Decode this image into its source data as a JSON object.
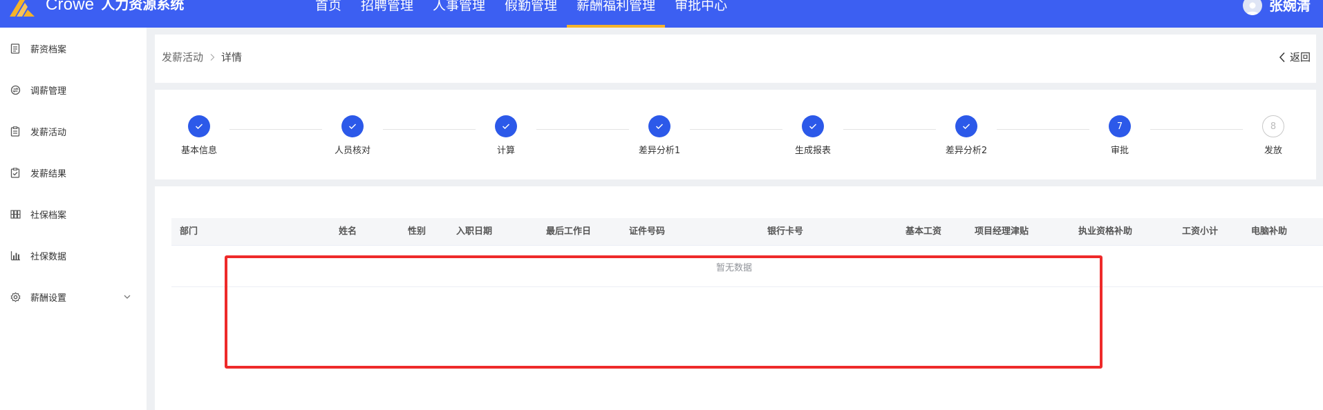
{
  "app": {
    "brand_en": "Crowe",
    "brand_cn": "人力资源系统",
    "user_name": "张婉清"
  },
  "colors": {
    "primary": "#3c5ff2",
    "accent": "#f5b32a",
    "step_done": "#2c59e9",
    "highlight": "#ee2a2a"
  },
  "nav": [
    {
      "label": "首页",
      "active": false
    },
    {
      "label": "招聘管理",
      "active": false
    },
    {
      "label": "人事管理",
      "active": false
    },
    {
      "label": "假勤管理",
      "active": false
    },
    {
      "label": "薪酬福利管理",
      "active": true
    },
    {
      "label": "审批中心",
      "active": false
    }
  ],
  "sidebar": [
    {
      "label": "薪资档案",
      "icon": "document-icon"
    },
    {
      "label": "调薪管理",
      "icon": "exchange-icon"
    },
    {
      "label": "发薪活动",
      "icon": "clipboard-icon"
    },
    {
      "label": "发薪结果",
      "icon": "clipboard-check-icon"
    },
    {
      "label": "社保档案",
      "icon": "archive-grid-icon"
    },
    {
      "label": "社保数据",
      "icon": "bar-chart-icon"
    },
    {
      "label": "薪酬设置",
      "icon": "gear-icon",
      "expandable": true
    }
  ],
  "breadcrumb": {
    "parent": "发薪活动",
    "current": "详情"
  },
  "back_label": "返回",
  "steps": [
    {
      "label": "基本信息",
      "status": "done"
    },
    {
      "label": "人员核对",
      "status": "done"
    },
    {
      "label": "计算",
      "status": "done"
    },
    {
      "label": "差异分析1",
      "status": "done"
    },
    {
      "label": "生成报表",
      "status": "done"
    },
    {
      "label": "差异分析2",
      "status": "done"
    },
    {
      "label": "审批",
      "status": "current",
      "number": "7"
    },
    {
      "label": "发放",
      "status": "pending",
      "number": "8"
    }
  ],
  "table": {
    "columns": [
      "部门",
      "姓名",
      "性别",
      "入职日期",
      "最后工作日",
      "证件号码",
      "银行卡号",
      "基本工资",
      "项目经理津贴",
      "执业资格补助",
      "工资小计",
      "电脑补助"
    ],
    "empty_text": "暂无数据"
  }
}
